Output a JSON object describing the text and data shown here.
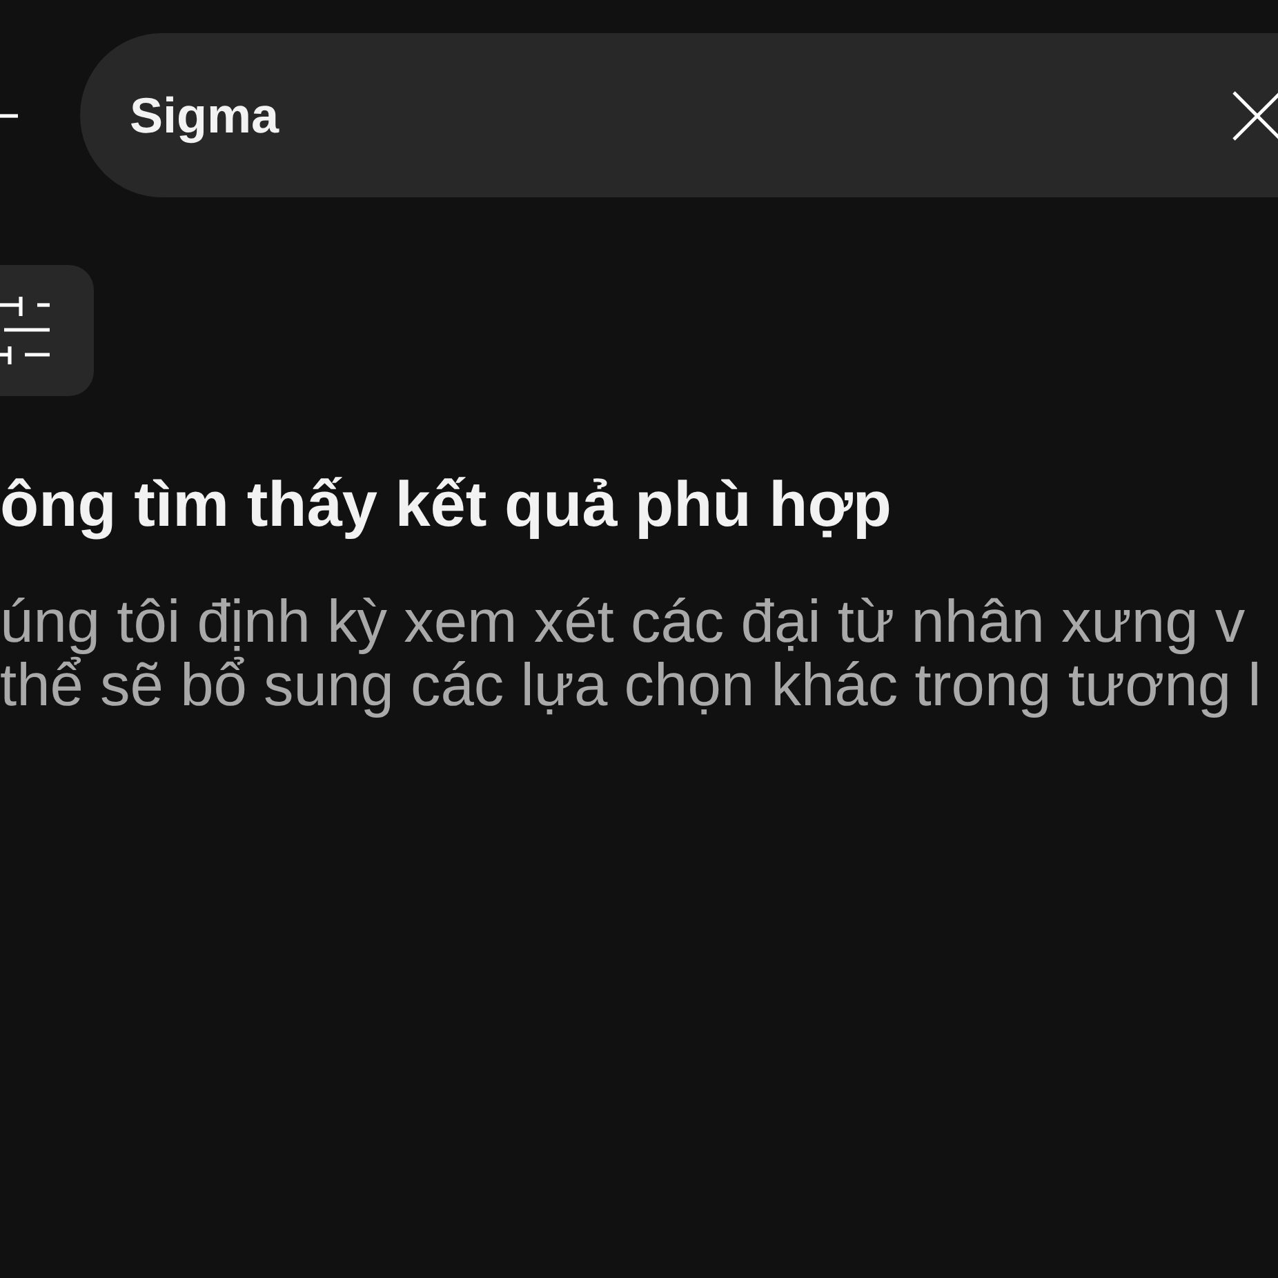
{
  "search": {
    "value": "Sigma"
  },
  "empty_state": {
    "title": "ông tìm thấy kết quả phù hợp",
    "description": [
      "úng tôi định kỳ xem xét các đại từ nhân xưng v",
      "thể sẽ bổ sung các lựa chọn khác trong tương l"
    ]
  }
}
